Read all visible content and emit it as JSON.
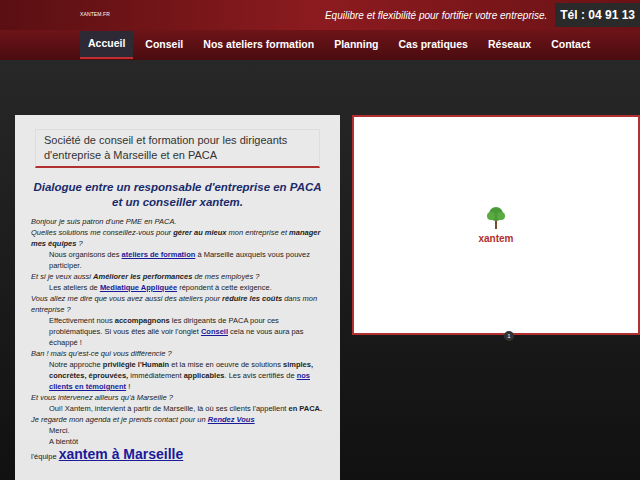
{
  "header": {
    "site": "XANTEM.FR",
    "tagline": "Equilibre et flexibilité pour fortifier votre entreprise.",
    "phone": "Tél : 04 91 13"
  },
  "nav": [
    {
      "label": "Accueil",
      "selected": true
    },
    {
      "label": "Conseil",
      "selected": false
    },
    {
      "label": "Nos ateliers formation",
      "selected": false
    },
    {
      "label": "Planning",
      "selected": false
    },
    {
      "label": "Cas pratiques",
      "selected": false
    },
    {
      "label": "Réseaux",
      "selected": false
    },
    {
      "label": "Contact",
      "selected": false
    }
  ],
  "intro": {
    "title": "Société de conseil et formation pour les dirigeants d'entreprise à Marseille et en PACA",
    "subtitle": "Dialogue entre un responsable d'entreprise en PACA et un conseiller xantem."
  },
  "dialogue": [
    {
      "kind": "question",
      "parts": [
        {
          "text": "Bonjour je suis patron d'une PME en PACA.",
          "style": "plain"
        }
      ]
    },
    {
      "kind": "question",
      "parts": [
        {
          "text": "Quelles solutions me conseillez-vous pour ",
          "style": "plain"
        },
        {
          "text": "gérer au mieux",
          "style": "bold"
        },
        {
          "text": " mon entreprise et ",
          "style": "plain"
        },
        {
          "text": "manager mes équipes",
          "style": "bold"
        },
        {
          "text": " ?",
          "style": "plain"
        }
      ]
    },
    {
      "kind": "answer",
      "parts": [
        {
          "text": "Nous organisons des ",
          "style": "plain"
        },
        {
          "text": "ateliers de formation",
          "style": "link"
        },
        {
          "text": " à Marseille auxquels vous pouvez participer.",
          "style": "plain"
        }
      ]
    },
    {
      "kind": "question",
      "parts": [
        {
          "text": "Et si je veux aussi ",
          "style": "plain"
        },
        {
          "text": "Améliorer les performances",
          "style": "bold"
        },
        {
          "text": " de mes employés ?",
          "style": "plain"
        }
      ]
    },
    {
      "kind": "answer",
      "parts": [
        {
          "text": "Les ateliers de ",
          "style": "plain"
        },
        {
          "text": "Mediatique Appliquée",
          "style": "link"
        },
        {
          "text": " répondent à cette exigence.",
          "style": "plain"
        }
      ]
    },
    {
      "kind": "question",
      "parts": [
        {
          "text": "Vous allez me dire que vous avez aussi des ateliers pour ",
          "style": "plain"
        },
        {
          "text": "réduire les coûts",
          "style": "bold"
        },
        {
          "text": " dans mon entreprise ?",
          "style": "plain"
        }
      ]
    },
    {
      "kind": "answer",
      "parts": [
        {
          "text": "Effectivement nous ",
          "style": "plain"
        },
        {
          "text": "accompagnons",
          "style": "bold"
        },
        {
          "text": " les dirigeants de PACA pour ces problématiques. Si vous êtes allé voir l'onglet ",
          "style": "plain"
        },
        {
          "text": "Conseil",
          "style": "link"
        },
        {
          "text": " cela ne vous aura pas échappé !",
          "style": "plain"
        }
      ]
    },
    {
      "kind": "question",
      "parts": [
        {
          "text": "Ban ! mais qu'est-ce qui vous différencie ?",
          "style": "plain"
        }
      ]
    },
    {
      "kind": "answer",
      "parts": [
        {
          "text": "Notre approche ",
          "style": "plain"
        },
        {
          "text": "privilégie l'Humain",
          "style": "bold"
        },
        {
          "text": " et la mise en oeuvre de solutions ",
          "style": "plain"
        },
        {
          "text": "simples, concrètes, éprouvées,",
          "style": "bold"
        },
        {
          "text": " immédiatement ",
          "style": "plain"
        },
        {
          "text": "applicables",
          "style": "bold"
        },
        {
          "text": ". Les avis certifiés de ",
          "style": "plain"
        },
        {
          "text": "nos clients en témoignent",
          "style": "link"
        },
        {
          "text": " !",
          "style": "plain"
        }
      ]
    },
    {
      "kind": "question",
      "parts": [
        {
          "text": "Et vous intervenez ailleurs qu'à Marseille ?",
          "style": "plain"
        }
      ]
    },
    {
      "kind": "answer",
      "parts": [
        {
          "text": "Oui! Xantem, intervient à partir de Marseille, là où ses clients l'appellent ",
          "style": "plain"
        },
        {
          "text": "en PACA.",
          "style": "bold"
        }
      ]
    },
    {
      "kind": "question",
      "parts": [
        {
          "text": "Je regarde mon agenda et je prends contact pour un ",
          "style": "plain"
        },
        {
          "text": "Rendez Vous",
          "style": "link"
        }
      ]
    },
    {
      "kind": "answer",
      "parts": [
        {
          "text": "Merci.",
          "style": "plain"
        }
      ]
    },
    {
      "kind": "answer",
      "parts": [
        {
          "text": "A bientôt",
          "style": "plain"
        }
      ]
    }
  ],
  "signature": {
    "prefix": "l'équipe ",
    "link": "xantem à Marseille"
  },
  "slide": {
    "logo": "xantem",
    "pager": "1"
  }
}
